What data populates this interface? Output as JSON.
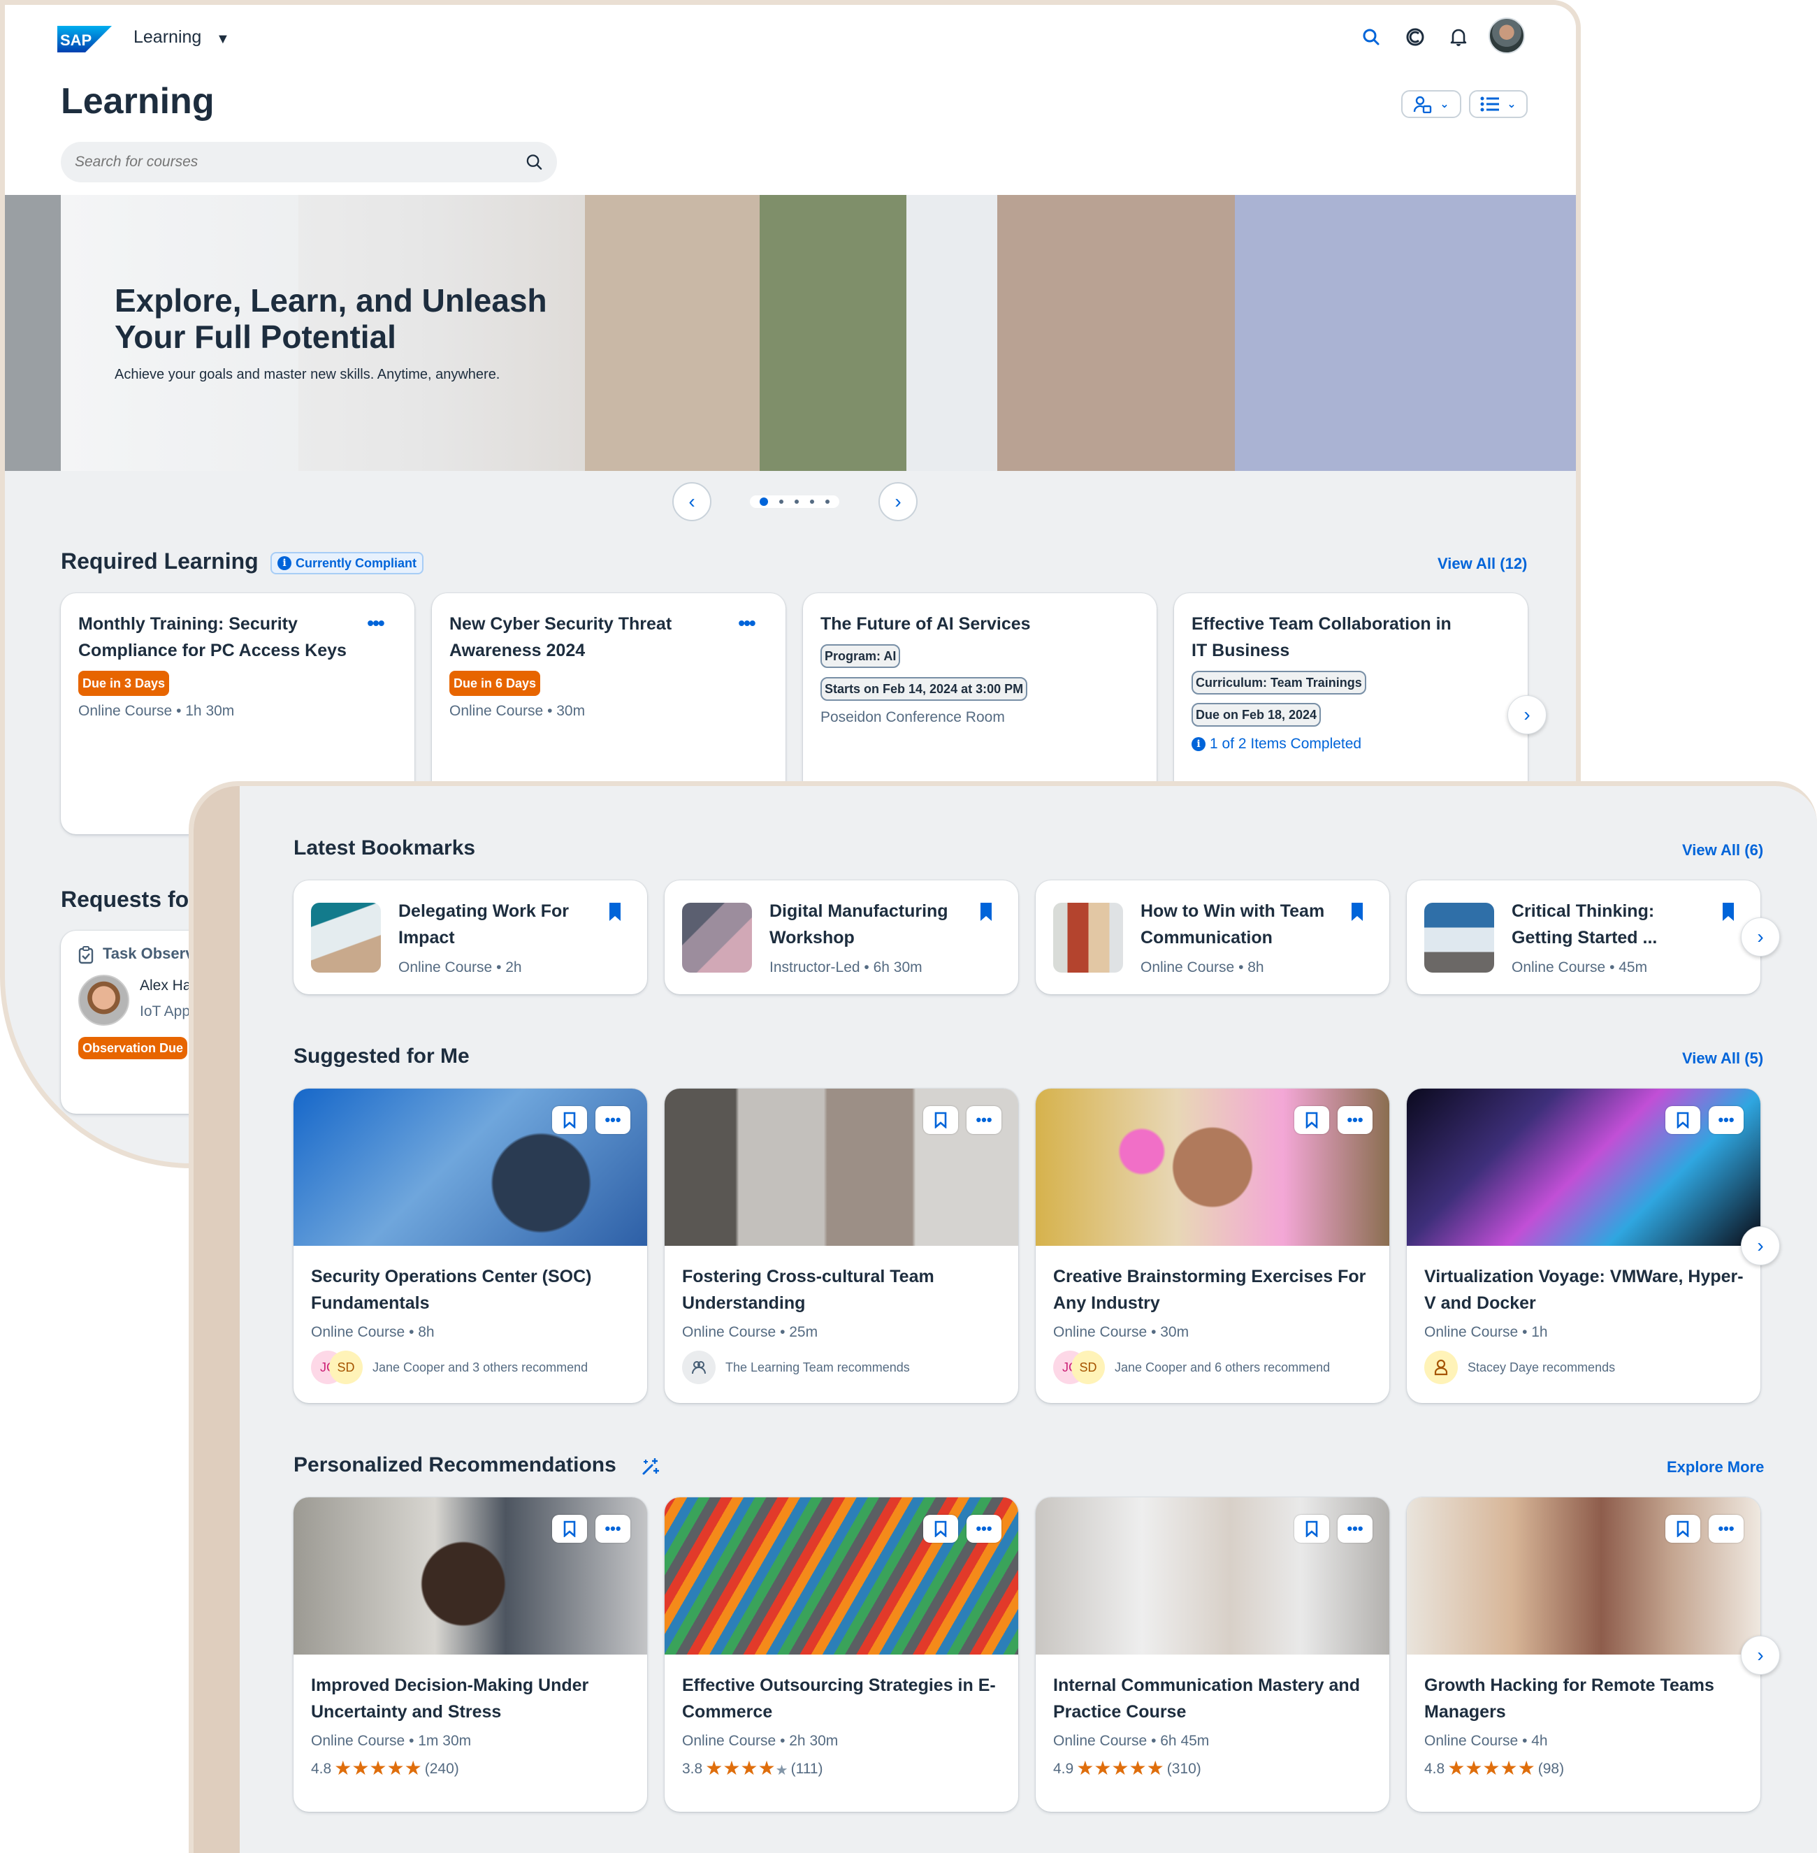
{
  "shell": {
    "logo": "SAP",
    "app_name": "Learning",
    "header_icons": [
      "search-icon",
      "copilot-icon",
      "bell-icon",
      "user-avatar"
    ]
  },
  "page": {
    "title": "Learning",
    "search_placeholder": "Search for courses",
    "toolbar_buttons": [
      "user-settings-menu",
      "list-view-menu"
    ]
  },
  "hero": {
    "title": "Explore, Learn, and Unleash Your Full Potential",
    "subtitle": "Achieve your goals and master new skills. Anytime, anywhere.",
    "slides_total": 5,
    "slide_active": 1
  },
  "required_learning": {
    "title": "Required Learning",
    "status_badge": "Currently Compliant",
    "view_all": "View All (12)",
    "cards": [
      {
        "title": "Monthly Training: Security Compliance for PC Access Keys",
        "due": "Due in 3 Days",
        "meta": "Online Course • 1h 30m"
      },
      {
        "title": "New Cyber Security Threat Awareness 2024",
        "due": "Due in 6 Days",
        "meta": "Online Course • 30m"
      },
      {
        "title": "The Future of AI Services",
        "tag1": "Program: AI",
        "tag2": "Starts on Feb 14, 2024 at 3:00 PM",
        "meta": "Poseidon Conference Room"
      },
      {
        "title": "Effective Team Collaboration in IT Business",
        "tag1": "Curriculum: Team Trainings",
        "tag2": "Due on Feb 18, 2024",
        "progress": "1 of 2 Items Completed"
      }
    ]
  },
  "requests": {
    "title": "Requests for",
    "card": {
      "type": "Task Observ",
      "name": "Alex Ha",
      "subtitle": "IoT App",
      "badge": "Observation Due"
    }
  },
  "bookmarks": {
    "title": "Latest Bookmarks",
    "view_all": "View All (6)",
    "cards": [
      {
        "title": "Delegating Work For Impact",
        "meta": "Online Course • 2h"
      },
      {
        "title": "Digital Manufacturing Workshop",
        "meta": "Instructor-Led • 6h 30m"
      },
      {
        "title": "How to Win with Team Communication",
        "meta": "Online Course • 8h"
      },
      {
        "title": "Critical Thinking: Getting Started ...",
        "meta": "Online Course • 45m"
      }
    ]
  },
  "suggested": {
    "title": "Suggested for Me",
    "view_all": "View All (5)",
    "cards": [
      {
        "title": "Security Operations Center (SOC) Fundamentals",
        "meta": "Online Course • 8h",
        "avatars": [
          "JC",
          "SD"
        ],
        "recommend": "Jane Cooper and 3 others recommend"
      },
      {
        "title": "Fostering Cross-cultural Team Understanding",
        "meta": "Online Course • 25m",
        "avatars": [
          "team-icon"
        ],
        "recommend": "The Learning Team recommends"
      },
      {
        "title": "Creative Brainstorming Exercises For Any Industry",
        "meta": "Online Course • 30m",
        "avatars": [
          "JC",
          "SD"
        ],
        "recommend": "Jane Cooper and 6 others recommend"
      },
      {
        "title": "Virtualization Voyage: VMWare, Hyper-V and Docker",
        "meta": "Online Course • 1h",
        "avatars": [
          "person-icon"
        ],
        "recommend": "Stacey Daye recommends"
      }
    ]
  },
  "personalized": {
    "title": "Personalized Recommendations",
    "explore_more": "Explore More",
    "cards": [
      {
        "title": "Improved Decision-Making Under Uncertainty and Stress",
        "meta": "Online Course • 1m 30m",
        "rating": "4.8",
        "stars_filled": 5,
        "reviews": "(240)"
      },
      {
        "title": "Effective Outsourcing Strategies in E-Commerce",
        "meta": "Online Course • 2h 30m",
        "rating": "3.8",
        "stars_filled": 4,
        "reviews": "(111)"
      },
      {
        "title": "Internal Communication Mastery and Practice Course",
        "meta": "Online Course • 6h 45m",
        "rating": "4.9",
        "stars_filled": 5,
        "reviews": "(310)"
      },
      {
        "title": "Growth Hacking for Remote Teams Managers",
        "meta": "Online Course • 4h",
        "rating": "4.8",
        "stars_filled": 5,
        "reviews": "(98)"
      }
    ]
  },
  "colors": {
    "accent": "#0064d9",
    "warning": "#e76500",
    "star": "#df6e0c",
    "frame": "#EADFD3"
  }
}
